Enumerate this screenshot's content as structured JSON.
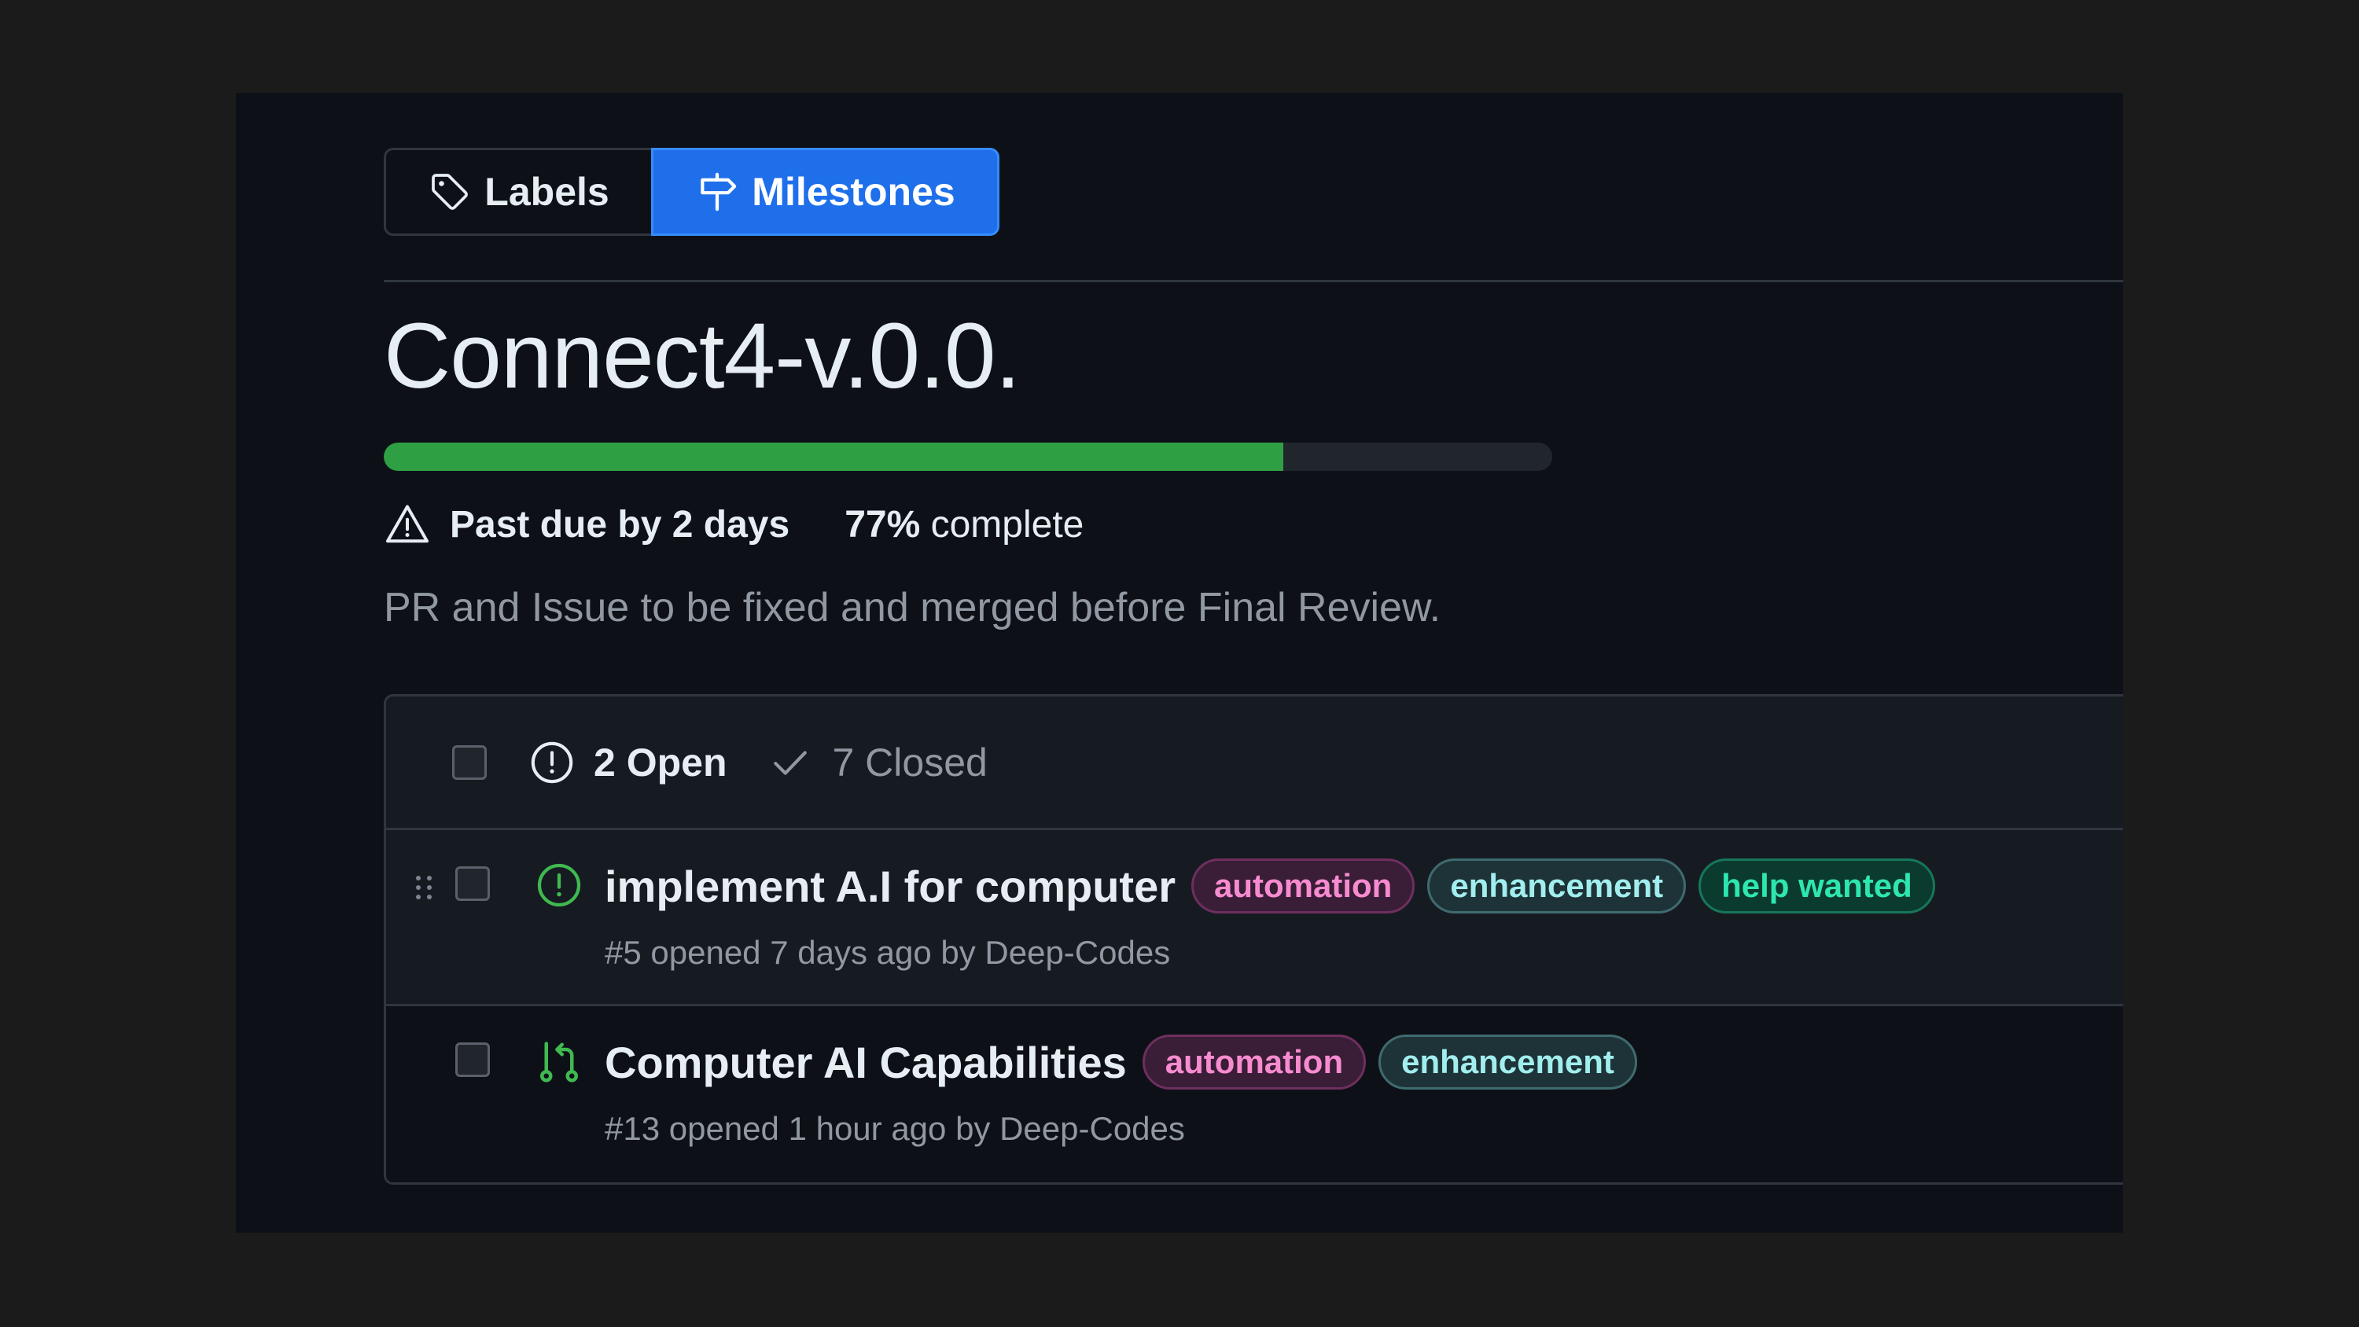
{
  "tabs": {
    "labels": "Labels",
    "milestones": "Milestones"
  },
  "milestone": {
    "title": "Connect4-v.0.0.",
    "progress_percent": 77,
    "due_text": "Past due by 2 days",
    "complete_pct": "77%",
    "complete_word": "complete",
    "description": "PR and Issue to be fixed and merged before Final Review."
  },
  "filters": {
    "open": "2 Open",
    "closed": "7 Closed"
  },
  "items": [
    {
      "type": "issue",
      "title": "implement A.I for computer",
      "labels": [
        "automation",
        "enhancement",
        "help wanted"
      ],
      "meta_prefix": "#5 opened 7 days ago by ",
      "author": "Deep-Codes"
    },
    {
      "type": "pull-request",
      "title": "Computer AI Capabilities",
      "labels": [
        "automation",
        "enhancement"
      ],
      "meta_prefix": "#13 opened 1 hour ago by ",
      "author": "Deep-Codes"
    }
  ],
  "colors": {
    "accent_blue": "#1f6feb",
    "progress_green": "#2ea043",
    "open_green": "#3fb950"
  }
}
